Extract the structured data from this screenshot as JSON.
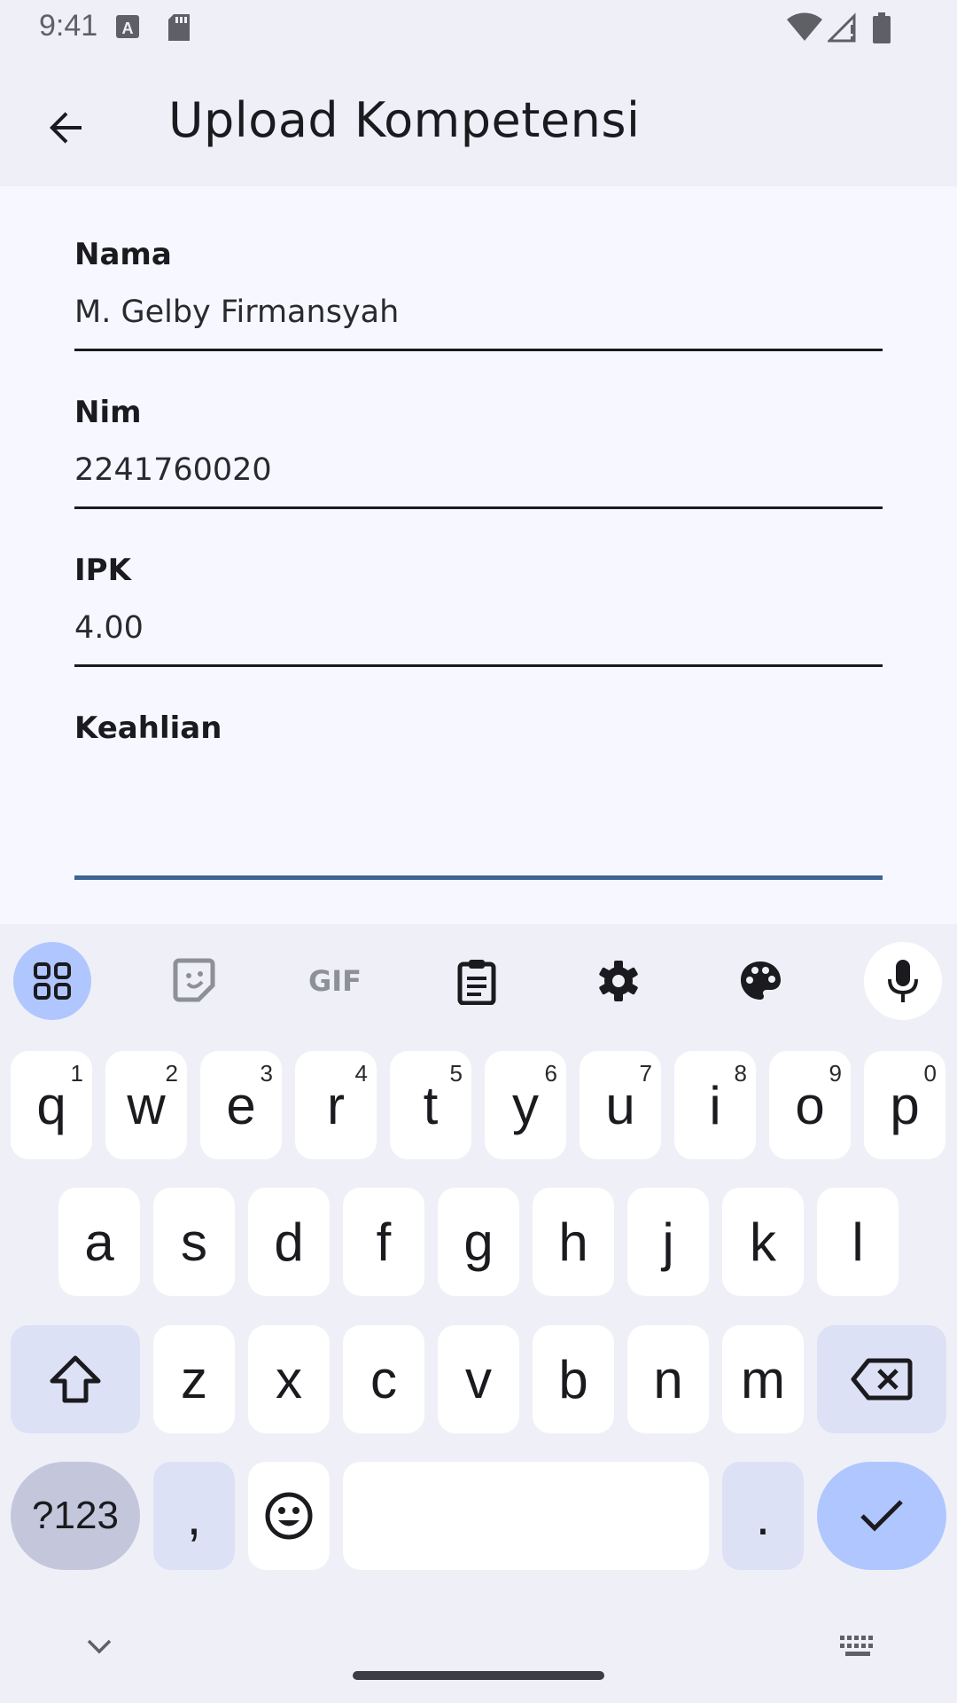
{
  "status_bar": {
    "time": "9:41"
  },
  "app_bar": {
    "title": "Upload Kompetensi"
  },
  "form": {
    "fields": [
      {
        "label": "Nama",
        "value": "M. Gelby Firmansyah"
      },
      {
        "label": "Nim",
        "value": "2241760020"
      },
      {
        "label": "IPK",
        "value": "4.00"
      },
      {
        "label": "Keahlian",
        "value": ""
      }
    ]
  },
  "keyboard": {
    "toolbar": [
      "apps-icon",
      "sticker-icon",
      "gif-icon",
      "clipboard-icon",
      "settings-icon",
      "palette-icon",
      "mic-icon"
    ],
    "gif_label": "GIF",
    "row1": [
      {
        "k": "q",
        "h": "1"
      },
      {
        "k": "w",
        "h": "2"
      },
      {
        "k": "e",
        "h": "3"
      },
      {
        "k": "r",
        "h": "4"
      },
      {
        "k": "t",
        "h": "5"
      },
      {
        "k": "y",
        "h": "6"
      },
      {
        "k": "u",
        "h": "7"
      },
      {
        "k": "i",
        "h": "8"
      },
      {
        "k": "o",
        "h": "9"
      },
      {
        "k": "p",
        "h": "0"
      }
    ],
    "row2": [
      "a",
      "s",
      "d",
      "f",
      "g",
      "h",
      "j",
      "k",
      "l"
    ],
    "row3": [
      "z",
      "x",
      "c",
      "v",
      "b",
      "n",
      "m"
    ],
    "symbols_label": "?123",
    "comma_label": ",",
    "period_label": ".",
    "colors": {
      "accent_focus": "#3e6593",
      "enter_key": "#b0c6ff",
      "mod_key": "#dde1f5"
    }
  }
}
